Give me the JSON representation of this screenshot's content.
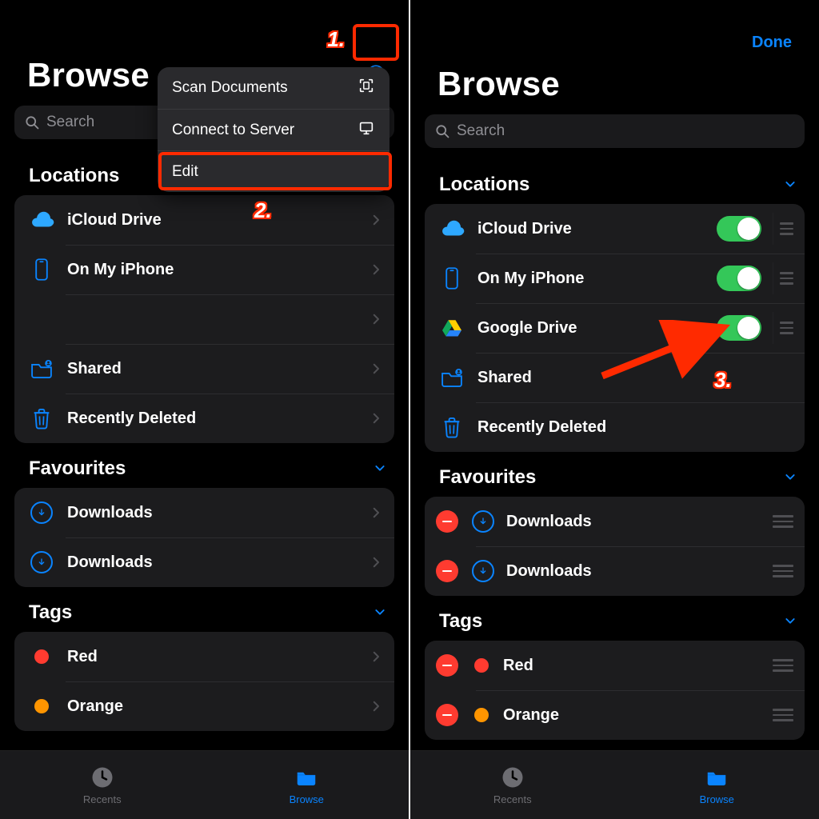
{
  "annotations": {
    "n1": "1.",
    "n2": "2.",
    "n3": "3."
  },
  "left": {
    "title": "Browse",
    "search_placeholder": "Search",
    "menu": {
      "scan": "Scan Documents",
      "connect": "Connect to Server",
      "edit": "Edit"
    },
    "locations": {
      "header": "Locations",
      "items": [
        {
          "label": "iCloud Drive"
        },
        {
          "label": "On My iPhone"
        },
        {
          "label": ""
        },
        {
          "label": "Shared"
        },
        {
          "label": "Recently Deleted"
        }
      ]
    },
    "favourites": {
      "header": "Favourites",
      "items": [
        {
          "label": "Downloads"
        },
        {
          "label": "Downloads"
        }
      ]
    },
    "tags": {
      "header": "Tags",
      "items": [
        {
          "label": "Red"
        },
        {
          "label": "Orange"
        }
      ]
    },
    "tabs": {
      "recents": "Recents",
      "browse": "Browse"
    }
  },
  "right": {
    "title": "Browse",
    "done": "Done",
    "search_placeholder": "Search",
    "locations": {
      "header": "Locations",
      "items": [
        {
          "label": "iCloud Drive"
        },
        {
          "label": "On My iPhone"
        },
        {
          "label": "Google Drive"
        },
        {
          "label": "Shared"
        },
        {
          "label": "Recently Deleted"
        }
      ]
    },
    "favourites": {
      "header": "Favourites",
      "items": [
        {
          "label": "Downloads"
        },
        {
          "label": "Downloads"
        }
      ]
    },
    "tags": {
      "header": "Tags",
      "items": [
        {
          "label": "Red"
        },
        {
          "label": "Orange"
        }
      ]
    },
    "tabs": {
      "recents": "Recents",
      "browse": "Browse"
    }
  }
}
